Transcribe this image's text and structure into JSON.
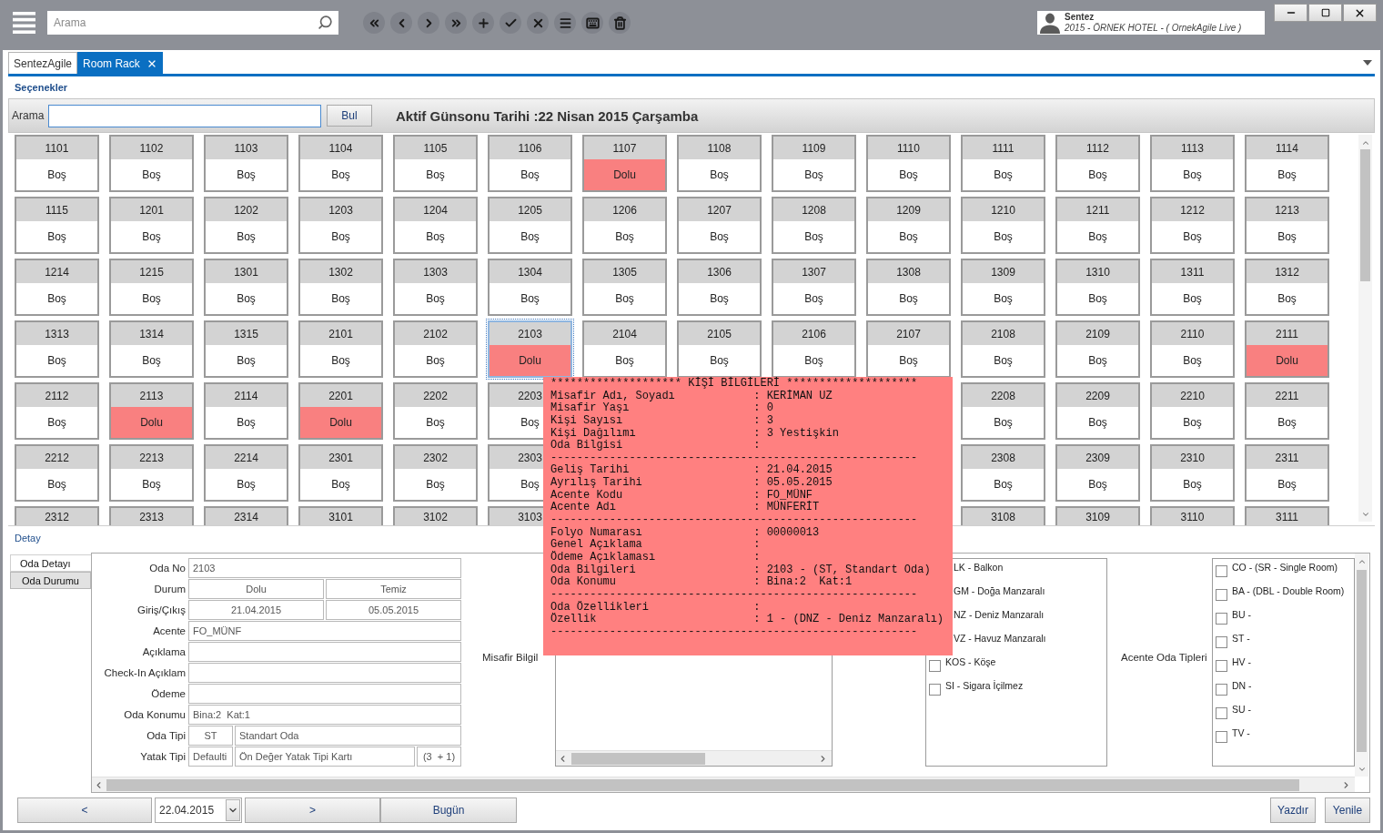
{
  "top_bar": {
    "search": {
      "placeholder": "Arama"
    },
    "user": {
      "name": "Sentez",
      "subtitle": "2015 - ÖRNEK HOTEL - ( OrnekAgile Live )"
    }
  },
  "tabs": [
    {
      "label": "SentezAgile",
      "selected": false
    },
    {
      "label": "Room Rack",
      "selected": true
    }
  ],
  "options_header": "Seçenekler",
  "search_bar": {
    "label": "Arama",
    "button": "Bul",
    "title": "Aktif Günsonu Tarihi :22 Nisan 2015 Çarşamba"
  },
  "room_rack": {
    "rows": [
      [
        {
          "number": "1101",
          "status": "Boş",
          "occupied": false,
          "selected": false
        },
        {
          "number": "1102",
          "status": "Boş",
          "occupied": false,
          "selected": false
        },
        {
          "number": "1103",
          "status": "Boş",
          "occupied": false,
          "selected": false
        },
        {
          "number": "1104",
          "status": "Boş",
          "occupied": false,
          "selected": false
        },
        {
          "number": "1105",
          "status": "Boş",
          "occupied": false,
          "selected": false
        },
        {
          "number": "1106",
          "status": "Boş",
          "occupied": false,
          "selected": false
        },
        {
          "number": "1107",
          "status": "Dolu",
          "occupied": true,
          "selected": false
        },
        {
          "number": "1108",
          "status": "Boş",
          "occupied": false,
          "selected": false
        },
        {
          "number": "1109",
          "status": "Boş",
          "occupied": false,
          "selected": false
        },
        {
          "number": "1110",
          "status": "Boş",
          "occupied": false,
          "selected": false
        },
        {
          "number": "1111",
          "status": "Boş",
          "occupied": false,
          "selected": false
        },
        {
          "number": "1112",
          "status": "Boş",
          "occupied": false,
          "selected": false
        },
        {
          "number": "1113",
          "status": "Boş",
          "occupied": false,
          "selected": false
        },
        {
          "number": "1114",
          "status": "Boş",
          "occupied": false,
          "selected": false
        }
      ],
      [
        {
          "number": "1115",
          "status": "Boş",
          "occupied": false,
          "selected": false
        },
        {
          "number": "1201",
          "status": "Boş",
          "occupied": false,
          "selected": false
        },
        {
          "number": "1202",
          "status": "Boş",
          "occupied": false,
          "selected": false
        },
        {
          "number": "1203",
          "status": "Boş",
          "occupied": false,
          "selected": false
        },
        {
          "number": "1204",
          "status": "Boş",
          "occupied": false,
          "selected": false
        },
        {
          "number": "1205",
          "status": "Boş",
          "occupied": false,
          "selected": false
        },
        {
          "number": "1206",
          "status": "Boş",
          "occupied": false,
          "selected": false
        },
        {
          "number": "1207",
          "status": "Boş",
          "occupied": false,
          "selected": false
        },
        {
          "number": "1208",
          "status": "Boş",
          "occupied": false,
          "selected": false
        },
        {
          "number": "1209",
          "status": "Boş",
          "occupied": false,
          "selected": false
        },
        {
          "number": "1210",
          "status": "Boş",
          "occupied": false,
          "selected": false
        },
        {
          "number": "1211",
          "status": "Boş",
          "occupied": false,
          "selected": false
        },
        {
          "number": "1212",
          "status": "Boş",
          "occupied": false,
          "selected": false
        },
        {
          "number": "1213",
          "status": "Boş",
          "occupied": false,
          "selected": false
        }
      ],
      [
        {
          "number": "1214",
          "status": "Boş",
          "occupied": false,
          "selected": false
        },
        {
          "number": "1215",
          "status": "Boş",
          "occupied": false,
          "selected": false
        },
        {
          "number": "1301",
          "status": "Boş",
          "occupied": false,
          "selected": false
        },
        {
          "number": "1302",
          "status": "Boş",
          "occupied": false,
          "selected": false
        },
        {
          "number": "1303",
          "status": "Boş",
          "occupied": false,
          "selected": false
        },
        {
          "number": "1304",
          "status": "Boş",
          "occupied": false,
          "selected": false
        },
        {
          "number": "1305",
          "status": "Boş",
          "occupied": false,
          "selected": false
        },
        {
          "number": "1306",
          "status": "Boş",
          "occupied": false,
          "selected": false
        },
        {
          "number": "1307",
          "status": "Boş",
          "occupied": false,
          "selected": false
        },
        {
          "number": "1308",
          "status": "Boş",
          "occupied": false,
          "selected": false
        },
        {
          "number": "1309",
          "status": "Boş",
          "occupied": false,
          "selected": false
        },
        {
          "number": "1310",
          "status": "Boş",
          "occupied": false,
          "selected": false
        },
        {
          "number": "1311",
          "status": "Boş",
          "occupied": false,
          "selected": false
        },
        {
          "number": "1312",
          "status": "Boş",
          "occupied": false,
          "selected": false
        }
      ],
      [
        {
          "number": "1313",
          "status": "Boş",
          "occupied": false,
          "selected": false
        },
        {
          "number": "1314",
          "status": "Boş",
          "occupied": false,
          "selected": false
        },
        {
          "number": "1315",
          "status": "Boş",
          "occupied": false,
          "selected": false
        },
        {
          "number": "2101",
          "status": "Boş",
          "occupied": false,
          "selected": false
        },
        {
          "number": "2102",
          "status": "Boş",
          "occupied": false,
          "selected": false
        },
        {
          "number": "2103",
          "status": "Dolu",
          "occupied": true,
          "selected": true
        },
        {
          "number": "2104",
          "status": "Boş",
          "occupied": false,
          "selected": false
        },
        {
          "number": "2105",
          "status": "Boş",
          "occupied": false,
          "selected": false
        },
        {
          "number": "2106",
          "status": "Boş",
          "occupied": false,
          "selected": false
        },
        {
          "number": "2107",
          "status": "Boş",
          "occupied": false,
          "selected": false
        },
        {
          "number": "2108",
          "status": "Boş",
          "occupied": false,
          "selected": false
        },
        {
          "number": "2109",
          "status": "Boş",
          "occupied": false,
          "selected": false
        },
        {
          "number": "2110",
          "status": "Boş",
          "occupied": false,
          "selected": false
        },
        {
          "number": "2111",
          "status": "Dolu",
          "occupied": true,
          "selected": false
        }
      ],
      [
        {
          "number": "2112",
          "status": "Boş",
          "occupied": false,
          "selected": false
        },
        {
          "number": "2113",
          "status": "Dolu",
          "occupied": true,
          "selected": false
        },
        {
          "number": "2114",
          "status": "Boş",
          "occupied": false,
          "selected": false
        },
        {
          "number": "2201",
          "status": "Dolu",
          "occupied": true,
          "selected": false
        },
        {
          "number": "2202",
          "status": "Boş",
          "occupied": false,
          "selected": false
        },
        {
          "number": "2203",
          "status": "Boş",
          "occupied": false,
          "selected": false
        },
        null,
        null,
        null,
        null,
        {
          "number": "2208",
          "status": "Boş",
          "occupied": false,
          "selected": false
        },
        {
          "number": "2209",
          "status": "Boş",
          "occupied": false,
          "selected": false
        },
        {
          "number": "2210",
          "status": "Boş",
          "occupied": false,
          "selected": false
        },
        {
          "number": "2211",
          "status": "Boş",
          "occupied": false,
          "selected": false
        }
      ],
      [
        {
          "number": "2212",
          "status": "Boş",
          "occupied": false,
          "selected": false
        },
        {
          "number": "2213",
          "status": "Boş",
          "occupied": false,
          "selected": false
        },
        {
          "number": "2214",
          "status": "Boş",
          "occupied": false,
          "selected": false
        },
        {
          "number": "2301",
          "status": "Boş",
          "occupied": false,
          "selected": false
        },
        {
          "number": "2302",
          "status": "Boş",
          "occupied": false,
          "selected": false
        },
        {
          "number": "2303",
          "status": "Boş",
          "occupied": false,
          "selected": false
        },
        null,
        null,
        null,
        null,
        {
          "number": "2308",
          "status": "Boş",
          "occupied": false,
          "selected": false
        },
        {
          "number": "2309",
          "status": "Boş",
          "occupied": false,
          "selected": false
        },
        {
          "number": "2310",
          "status": "Boş",
          "occupied": false,
          "selected": false
        },
        {
          "number": "2311",
          "status": "Boş",
          "occupied": false,
          "selected": false
        }
      ],
      [
        {
          "number": "2312",
          "selected": false
        },
        {
          "number": "2313",
          "selected": false
        },
        {
          "number": "2314",
          "selected": false
        },
        {
          "number": "3101",
          "selected": false
        },
        {
          "number": "3102",
          "selected": false
        },
        {
          "number": "3103",
          "selected": false
        },
        null,
        null,
        null,
        null,
        {
          "number": "3108",
          "selected": false
        },
        {
          "number": "3109",
          "selected": false
        },
        {
          "number": "3110",
          "selected": false
        },
        {
          "number": "3111",
          "selected": false
        }
      ]
    ]
  },
  "tooltip": {
    "lines": [
      {
        "kind": "heading",
        "text": "******************** KİŞİ BİLGİLERİ ********************"
      },
      {
        "kind": "field",
        "label": "Misafir Adı, Soyadı",
        "value": ": KERİMAN UZ"
      },
      {
        "kind": "field",
        "label": "Misafir Yaşı",
        "value": ": 0"
      },
      {
        "kind": "field",
        "label": "Kişi Sayısı",
        "value": ": 3"
      },
      {
        "kind": "field",
        "label": "Kişi Dağılımı",
        "value": ": 3 Yestişkin"
      },
      {
        "kind": "field",
        "label": "Oda Bilgisi",
        "value": ":"
      },
      {
        "kind": "rule",
        "text": "--------------------------------------------------------"
      },
      {
        "kind": "field",
        "label": "Geliş Tarihi",
        "value": ": 21.04.2015"
      },
      {
        "kind": "field",
        "label": "Ayrılış Tarihi",
        "value": ": 05.05.2015"
      },
      {
        "kind": "field",
        "label": "Acente Kodu",
        "value": ": FO_MÜNF"
      },
      {
        "kind": "field",
        "label": "Acente Adı",
        "value": ": MÜNFERİT"
      },
      {
        "kind": "rule",
        "text": "--------------------------------------------------------"
      },
      {
        "kind": "field",
        "label": "Folyo Numarası",
        "value": ": 00000013"
      },
      {
        "kind": "field",
        "label": "Genel Açıklama",
        "value": ":"
      },
      {
        "kind": "field",
        "label": "Ödeme Açıklaması",
        "value": ":"
      },
      {
        "kind": "field",
        "label": "Oda Bilgileri",
        "value": ": 2103 - (ST, Standart Oda)"
      },
      {
        "kind": "field",
        "label": "Oda Konumu",
        "value": ": Bina:2  Kat:1"
      },
      {
        "kind": "rule",
        "text": "--------------------------------------------------------"
      },
      {
        "kind": "field",
        "label": "Oda Özellikleri",
        "value": ":"
      },
      {
        "kind": "field",
        "label": "Özellik",
        "value": ": 1 - (DNZ - Deniz Manzaralı)"
      },
      {
        "kind": "rule",
        "text": "--------------------------------------------------------"
      }
    ]
  },
  "detail": {
    "title": "Detay",
    "tabs": [
      {
        "label": "Oda Detayı",
        "selected": true
      },
      {
        "label": "Oda Durumu",
        "selected": false
      }
    ],
    "form": [
      {
        "label": "Oda No",
        "kind": "single",
        "values": [
          "2103"
        ]
      },
      {
        "label": "Durum",
        "kind": "pair",
        "values": [
          "Dolu",
          "Temiz"
        ]
      },
      {
        "label": "Giriş/Çıkış",
        "kind": "pair",
        "values": [
          "21.04.2015",
          "05.05.2015"
        ]
      },
      {
        "label": "Acente",
        "kind": "single",
        "values": [
          "FO_MÜNF"
        ]
      },
      {
        "label": "Açıklama",
        "kind": "single"
      },
      {
        "label": "Check-In Açıklam",
        "kind": "single"
      },
      {
        "label": "Ödeme",
        "kind": "single"
      },
      {
        "label": "Oda Konumu",
        "kind": "single",
        "values": [
          "Bina:2  Kat:1"
        ]
      },
      {
        "label": "Oda Tipi",
        "kind": "code_name",
        "values": [
          "ST",
          "Standart Oda"
        ]
      },
      {
        "label": "Yatak Tipi",
        "kind": "code_name_extra",
        "values": [
          "Defaulti",
          "Ön Değer Yatak Tipi Kartı",
          "(3  + 1)"
        ]
      }
    ],
    "guest_info_label": "Misafir Bilgil",
    "features": [
      {
        "label": "LK - Balkon"
      },
      {
        "label": "GM - Doğa Manzaralı"
      },
      {
        "label": "NZ - Deniz Manzaralı"
      },
      {
        "label": "VZ - Havuz Manzaralı"
      },
      {
        "label": "KOS - Köşe",
        "checked": false
      },
      {
        "label": "SI - Sigara İçilmez",
        "checked": false
      }
    ],
    "agency_room_types_label": "Acente Oda Tipleri",
    "agency_room_types": [
      {
        "label": "CO - (SR - Single Room)",
        "checked": false
      },
      {
        "label": "BA - (DBL - Double Room)",
        "checked": false
      },
      {
        "label": "BU -",
        "checked": false
      },
      {
        "label": "ST -",
        "checked": false
      },
      {
        "label": "HV -",
        "checked": false
      },
      {
        "label": "DN -",
        "checked": false
      },
      {
        "label": "SU -",
        "checked": false
      },
      {
        "label": "TV -",
        "checked": false
      }
    ]
  },
  "bottom_bar": {
    "previous": "<",
    "date": "22.04.2015",
    "next": ">",
    "today": "Bugün",
    "print": "Yazdır",
    "refresh": "Yenile"
  }
}
